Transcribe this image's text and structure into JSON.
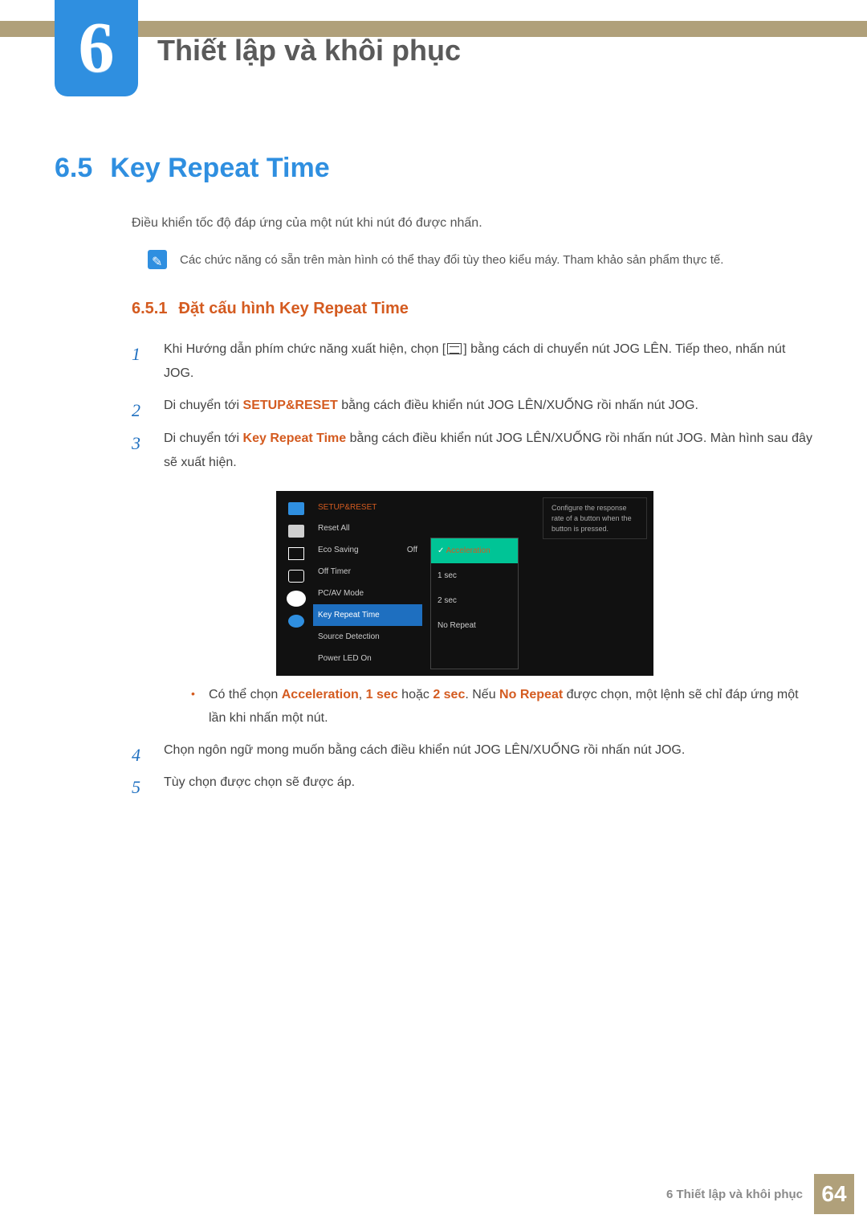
{
  "chapter": {
    "number": "6",
    "title": "Thiết lập và khôi phục"
  },
  "section": {
    "number": "6.5",
    "title": "Key Repeat Time",
    "intro": "Điều khiển tốc độ đáp ứng của một nút khi nút đó được nhấn.",
    "note": "Các chức năng có sẵn trên màn hình có thể thay đổi tùy theo kiểu máy. Tham khảo sản phẩm thực tế."
  },
  "subsection": {
    "number": "6.5.1",
    "title": "Đặt cấu hình Key Repeat Time"
  },
  "steps": {
    "s1a": "Khi Hướng dẫn phím chức năng xuất hiện, chọn [",
    "s1b": "] bằng cách di chuyển nút JOG LÊN. Tiếp theo, nhấn nút JOG.",
    "s2a": "Di chuyển tới ",
    "s2kw": "SETUP&RESET",
    "s2b": " bằng cách điều khiển nút JOG LÊN/XUỐNG rồi nhấn nút JOG.",
    "s3a": "Di chuyển tới ",
    "s3kw": "Key Repeat Time",
    "s3b": " bằng cách điều khiển nút JOG LÊN/XUỐNG rồi nhấn nút JOG. Màn hình sau đây sẽ xuất hiện.",
    "s4": "Chọn ngôn ngữ mong muốn bằng cách điều khiển nút JOG LÊN/XUỐNG rồi nhấn nút JOG.",
    "s5": "Tùy chọn được chọn sẽ được áp."
  },
  "bullet": {
    "a": "Có thể chọn ",
    "kwAccel": "Acceleration",
    "sep1": ", ",
    "kw1s": "1 sec",
    "sep2": " hoặc ",
    "kw2s": "2 sec",
    "sep3": ". Nếu ",
    "kwNR": "No Repeat",
    "b": " được chọn, một lệnh sẽ chỉ đáp ứng một lần khi nhấn một nút."
  },
  "osd": {
    "menuTitle": "SETUP&RESET",
    "items": {
      "reset": "Reset All",
      "eco": "Eco Saving",
      "ecoVal": "Off",
      "offtimer": "Off Timer",
      "pcav": "PC/AV Mode",
      "krt": "Key Repeat Time",
      "sd": "Source Detection",
      "pled": "Power LED On"
    },
    "popup": {
      "accel": "Acceleration",
      "s1": "1 sec",
      "s2": "2 sec",
      "nr": "No Repeat"
    },
    "help": "Configure the response rate of a button when the button is pressed."
  },
  "footer": {
    "text": "6 Thiết lập và khôi phục",
    "page": "64"
  }
}
